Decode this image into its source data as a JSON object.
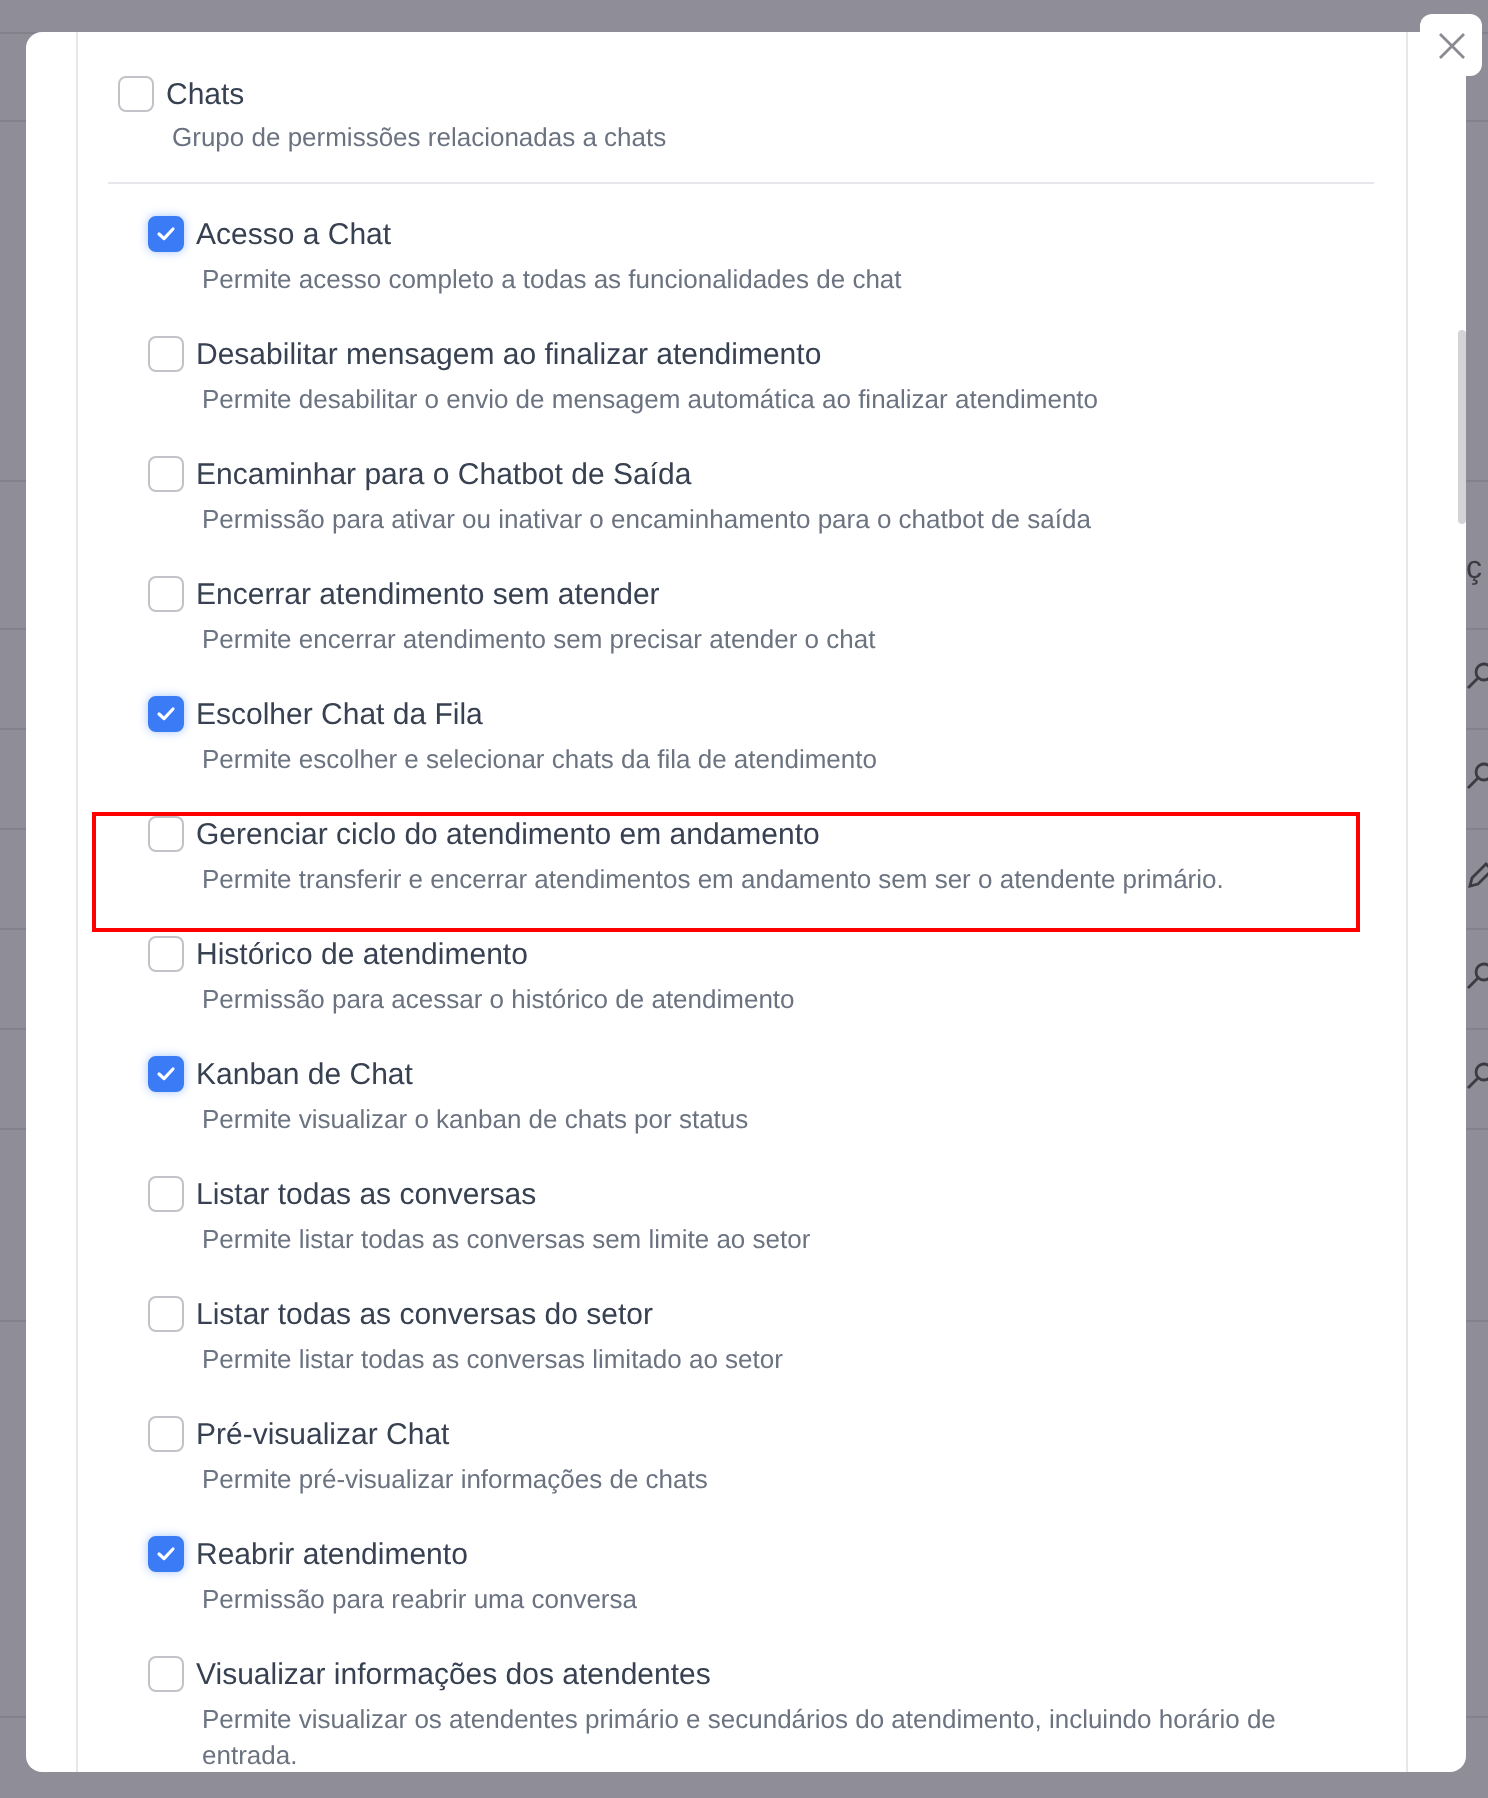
{
  "background": {
    "column_header": "ç"
  },
  "group": {
    "label": "Chats",
    "description": "Grupo de permissões relacionadas a chats",
    "checked": false
  },
  "permissions": [
    {
      "label": "Acesso a Chat",
      "description": "Permite acesso completo a todas as funcionalidades de chat",
      "checked": true,
      "highlighted": false
    },
    {
      "label": "Desabilitar mensagem ao finalizar atendimento",
      "description": "Permite desabilitar o envio de mensagem automática ao finalizar atendimento",
      "checked": false,
      "highlighted": false
    },
    {
      "label": "Encaminhar para o Chatbot de Saída",
      "description": "Permissão para ativar ou inativar o encaminhamento para o chatbot de saída",
      "checked": false,
      "highlighted": false
    },
    {
      "label": "Encerrar atendimento sem atender",
      "description": "Permite encerrar atendimento sem precisar atender o chat",
      "checked": false,
      "highlighted": false
    },
    {
      "label": "Escolher Chat da Fila",
      "description": "Permite escolher e selecionar chats da fila de atendimento",
      "checked": true,
      "highlighted": false
    },
    {
      "label": "Gerenciar ciclo do atendimento em andamento",
      "description": "Permite transferir e encerrar atendimentos em andamento sem ser o atendente primário.",
      "checked": false,
      "highlighted": true
    },
    {
      "label": "Histórico de atendimento",
      "description": "Permissão para acessar o histórico de atendimento",
      "checked": false,
      "highlighted": false
    },
    {
      "label": "Kanban de Chat",
      "description": "Permite visualizar o kanban de chats por status",
      "checked": true,
      "highlighted": false
    },
    {
      "label": "Listar todas as conversas",
      "description": "Permite listar todas as conversas sem limite ao setor",
      "checked": false,
      "highlighted": false
    },
    {
      "label": "Listar todas as conversas do setor",
      "description": "Permite listar todas as conversas limitado ao setor",
      "checked": false,
      "highlighted": false
    },
    {
      "label": "Pré-visualizar Chat",
      "description": "Permite pré-visualizar informações de chats",
      "checked": false,
      "highlighted": false
    },
    {
      "label": "Reabrir atendimento",
      "description": "Permissão para reabrir uma conversa",
      "checked": true,
      "highlighted": false
    },
    {
      "label": "Visualizar informações dos atendentes",
      "description": "Permite visualizar os atendentes primário e secundários do atendimento, incluindo horário de entrada.",
      "checked": false,
      "highlighted": false
    }
  ]
}
